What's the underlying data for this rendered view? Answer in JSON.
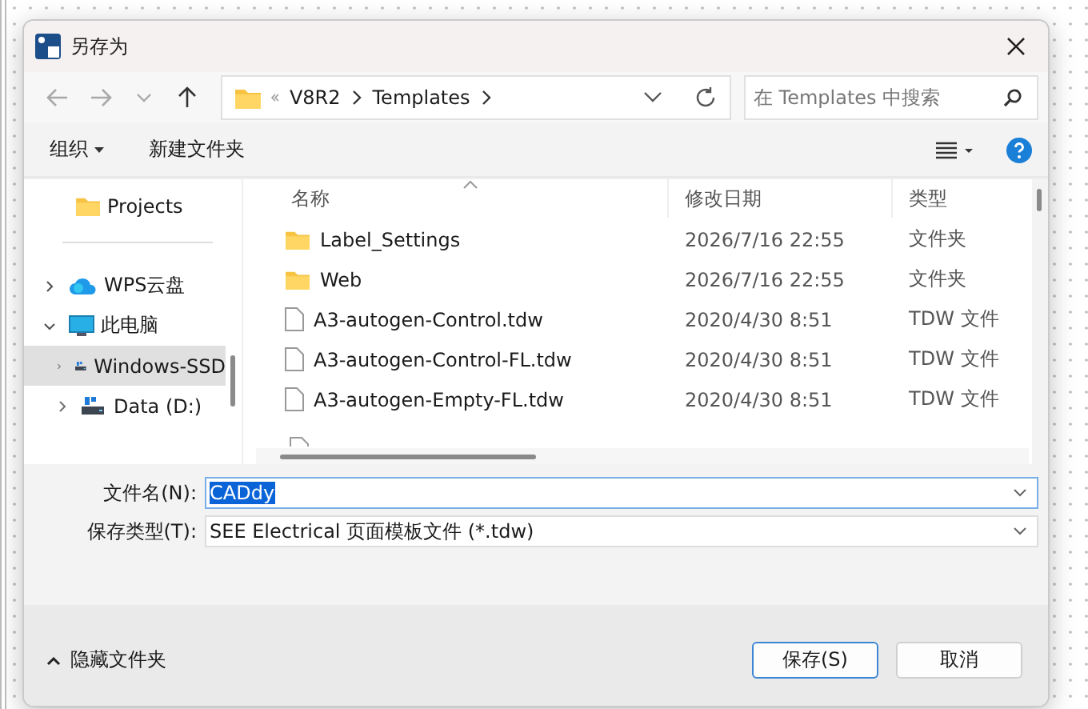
{
  "window": {
    "title": "另存为"
  },
  "nav": {
    "buttons": [
      {
        "kind": "back",
        "disabled": true
      },
      {
        "kind": "forward",
        "disabled": true
      },
      {
        "kind": "recent",
        "disabled": true
      },
      {
        "kind": "up",
        "disabled": false
      }
    ],
    "path": [
      "V8R2",
      "Templates"
    ],
    "search": {
      "placeholder": "在 Templates 中搜索"
    }
  },
  "toolbar": {
    "organize": "组织",
    "new_folder": "新建文件夹"
  },
  "sidebar": {
    "quick_access": [
      {
        "label": "Projects",
        "kind": "folder",
        "selected": false
      }
    ],
    "tree": [
      {
        "label": "WPS云盘",
        "kind": "cloud",
        "expanded": false,
        "selected": false
      },
      {
        "label": "此电脑",
        "kind": "pc",
        "expanded": true,
        "selected": false,
        "children": [
          {
            "label": "Windows-SSD",
            "kind": "drive",
            "expanded": false,
            "selected": true
          },
          {
            "label": "Data (D:)",
            "kind": "drive",
            "expanded": false,
            "selected": false
          }
        ]
      }
    ]
  },
  "table": {
    "columns": [
      {
        "label": "名称",
        "sorted": true
      },
      {
        "label": "修改日期",
        "sorted": false
      },
      {
        "label": "类型",
        "sorted": false
      }
    ],
    "rows": [
      {
        "name": "Label_Settings",
        "date": "2026/7/16 22:55",
        "type": "文件夹",
        "kind": "folder"
      },
      {
        "name": "Web",
        "date": "2026/7/16 22:55",
        "type": "文件夹",
        "kind": "folder"
      },
      {
        "name": "A3-autogen-Control.tdw",
        "date": "2020/4/30 8:51",
        "type": "TDW 文件",
        "kind": "file"
      },
      {
        "name": "A3-autogen-Control-FL.tdw",
        "date": "2020/4/30 8:51",
        "type": "TDW 文件",
        "kind": "file"
      },
      {
        "name": "A3-autogen-Empty-FL.tdw",
        "date": "2020/4/30 8:51",
        "type": "TDW 文件",
        "kind": "file"
      }
    ]
  },
  "form": {
    "filename": {
      "label": "文件名(N):",
      "value": "CADdy",
      "text_selected": true
    },
    "filetype": {
      "label": "保存类型(T):",
      "value": "SEE Electrical 页面模板文件 (*.tdw)"
    }
  },
  "footer": {
    "toggle": "隐藏文件夹",
    "buttons": [
      {
        "label": "保存(S)",
        "default": true
      },
      {
        "label": "取消",
        "default": false
      }
    ]
  }
}
